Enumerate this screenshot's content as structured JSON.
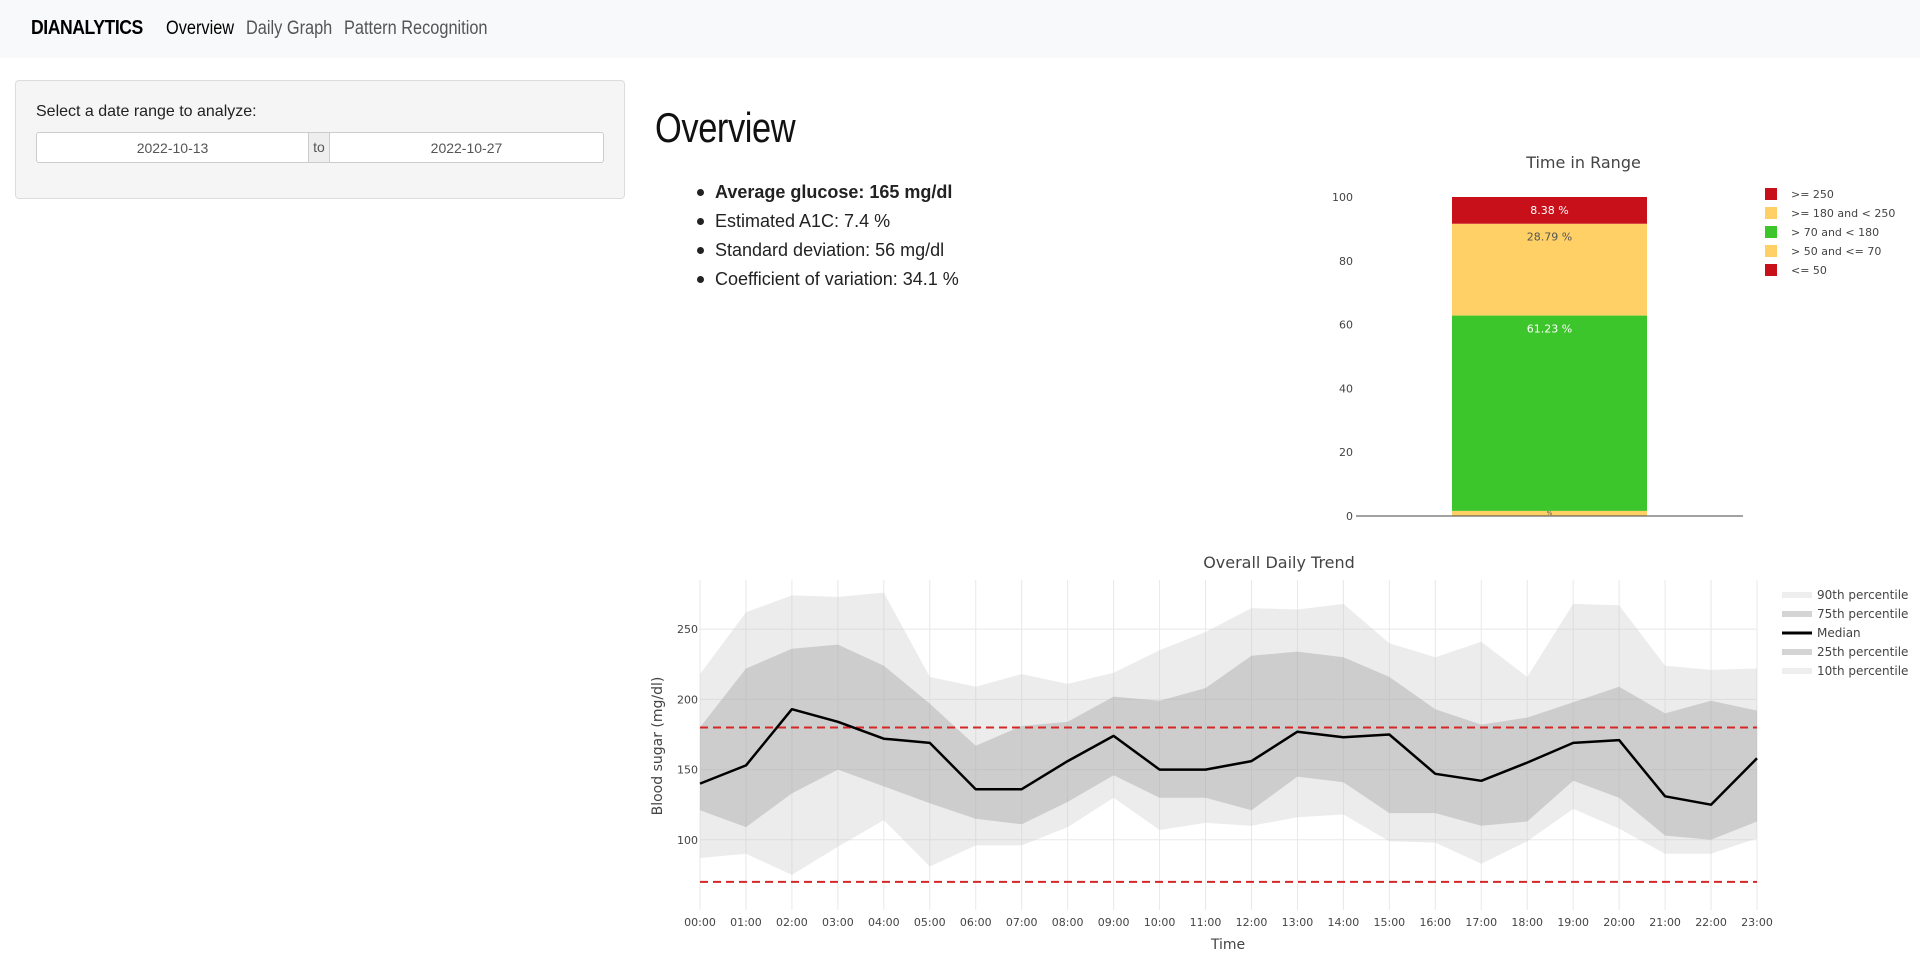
{
  "navbar": {
    "brand": "DIANALYTICS",
    "links": [
      {
        "label": "Overview",
        "active": true
      },
      {
        "label": "Daily Graph",
        "active": false
      },
      {
        "label": "Pattern Recognition",
        "active": false
      }
    ]
  },
  "sidebar": {
    "label": "Select a date range to analyze:",
    "start_date": "2022-10-13",
    "separator": "to",
    "end_date": "2022-10-27"
  },
  "main": {
    "title": "Overview",
    "stats": [
      "Average glucose: 165 mg/dl",
      "Estimated A1C: 7.4 %",
      "Standard deviation: 56 mg/dl",
      "Coefficient of variation: 34.1 %"
    ]
  },
  "chart_data": [
    {
      "type": "bar",
      "stacked": true,
      "title": "Time in Range",
      "ylim": [
        0,
        100
      ],
      "yticks": [
        0,
        20,
        40,
        60,
        80,
        100
      ],
      "legend_position": "top-right",
      "series": [
        {
          "name": "<= 50",
          "value": 0.0,
          "label": "",
          "color": "#c8101a"
        },
        {
          "name": "> 50 and <= 70",
          "value": 1.6,
          "label": "%",
          "color": "#fed065"
        },
        {
          "name": "> 70 and < 180",
          "value": 61.23,
          "label": "61.23 %",
          "color": "#3dc62b"
        },
        {
          "name": ">= 180 and < 250",
          "value": 28.79,
          "label": "28.79 %",
          "color": "#fed065"
        },
        {
          "name": ">= 250",
          "value": 8.38,
          "label": "8.38 %",
          "color": "#c8101a"
        }
      ]
    },
    {
      "type": "area",
      "title": "Overall Daily Trend",
      "xlabel": "Time",
      "ylabel": "Blood sugar (mg/dl)",
      "ylim": [
        50,
        285
      ],
      "yticks": [
        100,
        150,
        200,
        250
      ],
      "grid": true,
      "legend_position": "top-right",
      "thresholds": [
        {
          "value": 180,
          "color": "#d62728"
        },
        {
          "value": 70,
          "color": "#d62728"
        }
      ],
      "x": [
        "00:00",
        "01:00",
        "02:00",
        "03:00",
        "04:00",
        "05:00",
        "06:00",
        "07:00",
        "08:00",
        "09:00",
        "10:00",
        "11:00",
        "12:00",
        "13:00",
        "14:00",
        "15:00",
        "16:00",
        "17:00",
        "18:00",
        "19:00",
        "20:00",
        "21:00",
        "22:00",
        "23:00"
      ],
      "series": [
        {
          "name": "90th percentile",
          "values": [
            218,
            262,
            274,
            273,
            276,
            216,
            209,
            218,
            211,
            219,
            235,
            248,
            265,
            264,
            268,
            240,
            230,
            241,
            216,
            268,
            267,
            224,
            221,
            222
          ]
        },
        {
          "name": "75th percentile",
          "values": [
            180,
            222,
            236,
            239,
            224,
            197,
            167,
            181,
            184,
            202,
            199,
            208,
            231,
            234,
            230,
            216,
            193,
            182,
            187,
            198,
            209,
            190,
            199,
            192
          ]
        },
        {
          "name": "Median",
          "values": [
            140,
            153,
            193,
            184,
            172,
            169,
            136,
            136,
            156,
            174,
            150,
            150,
            156,
            177,
            173,
            175,
            147,
            142,
            155,
            169,
            171,
            131,
            125,
            158
          ]
        },
        {
          "name": "25th percentile",
          "values": [
            121,
            109,
            133,
            150,
            138,
            126,
            115,
            111,
            127,
            146,
            130,
            130,
            121,
            145,
            141,
            119,
            119,
            110,
            113,
            142,
            130,
            103,
            100,
            113
          ]
        },
        {
          "name": "10th percentile",
          "values": [
            87,
            90,
            75,
            95,
            114,
            81,
            96,
            96,
            109,
            130,
            107,
            112,
            110,
            116,
            118,
            99,
            98,
            83,
            99,
            122,
            108,
            90,
            90,
            101
          ]
        }
      ]
    }
  ]
}
